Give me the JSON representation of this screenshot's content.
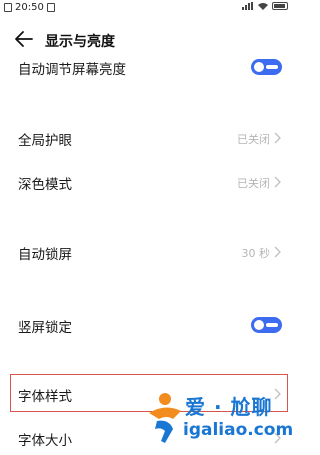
{
  "status_bar": {
    "time": "20:50"
  },
  "header": {
    "title": "显示与亮度",
    "back_icon": "arrow-left-icon"
  },
  "settings": {
    "auto_brightness": {
      "label": "自动调节屏幕亮度",
      "toggle_on": true
    },
    "eye_protection": {
      "label": "全局护眼",
      "value": "已关闭"
    },
    "dark_mode": {
      "label": "深色模式",
      "value": "已关闭"
    },
    "auto_lock": {
      "label": "自动锁屏",
      "value": "30 秒"
    },
    "portrait_lock": {
      "label": "竖屏锁定",
      "toggle_on": true
    },
    "font_style": {
      "label": "字体样式"
    },
    "font_size": {
      "label": "字体大小"
    }
  },
  "watermark": {
    "cn": "爱 · 尬聊",
    "en": "igaliao.com"
  },
  "colors": {
    "accent": "#3d6cf0",
    "highlight": "#d9534f",
    "secondary_text": "#b5b5b5",
    "watermark": "#1976d2"
  }
}
